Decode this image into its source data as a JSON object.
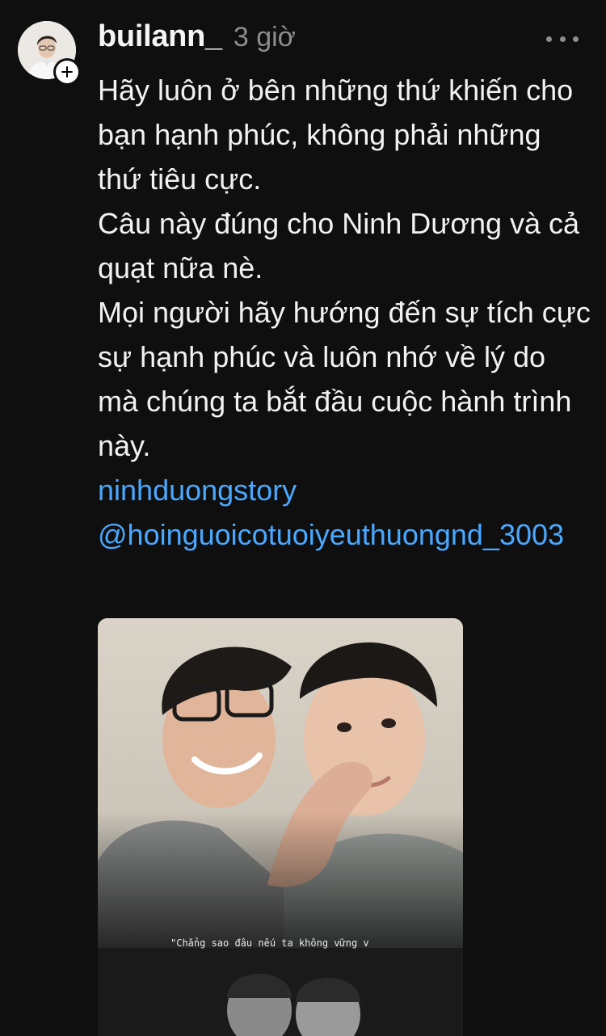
{
  "post": {
    "username": "builann_",
    "time": "3 giờ",
    "paragraphs": [
      "Hãy luôn ở bên những thứ khiến cho bạn hạnh phúc, không phải những thứ tiêu cực.",
      "Câu này đúng cho Ninh Dương và cả quạt nữa nè.",
      "Mọi người hãy hướng đến sự tích cực sự hạnh phúc và luôn nhớ về lý do mà chúng ta bắt đầu cuộc hành trình này."
    ],
    "hashtag": "ninhduongstory",
    "mention": "@hoinguoicotuoiyeuthuongnd_3003",
    "media": {
      "caption": "\"Chẳng sao đâu nếu ta không vững v"
    }
  },
  "icons": {
    "more": "more-horizontal-icon",
    "follow": "plus-icon"
  },
  "colors": {
    "background": "#0f0f0f",
    "text": "#f2f2f2",
    "muted": "#8c8c8c",
    "link": "#4aa8ff"
  }
}
